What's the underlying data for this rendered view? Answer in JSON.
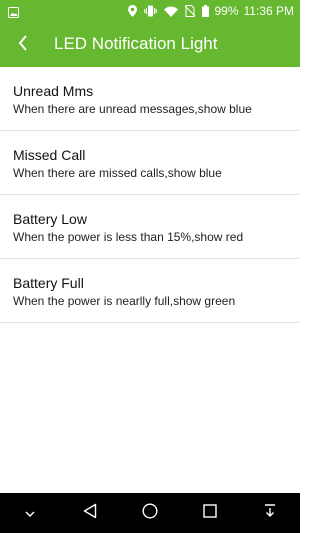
{
  "status_bar": {
    "battery_percent": "99%",
    "time": "11:36 PM"
  },
  "app_bar": {
    "title": "LED Notification Light"
  },
  "settings": {
    "items": [
      {
        "title": "Unread Mms",
        "subtitle": "When there are unread messages,show blue"
      },
      {
        "title": "Missed Call",
        "subtitle": "When there are missed calls,show blue"
      },
      {
        "title": "Battery Low",
        "subtitle": "When the power is less than 15%,show red"
      },
      {
        "title": "Battery Full",
        "subtitle": "When the power is nearlly full,show green"
      }
    ]
  },
  "icons": {
    "status_left": "image-notification-icon",
    "location": "location-icon",
    "vibrate": "vibrate-icon",
    "wifi": "wifi-icon",
    "no_sim": "no-sim-icon",
    "battery": "battery-icon",
    "back": "back-arrow-icon",
    "nav_down": "chevron-down-icon",
    "nav_back": "nav-back-icon",
    "nav_home": "home-icon",
    "nav_recents": "recents-icon",
    "nav_notifications": "pull-down-icon"
  },
  "colors": {
    "accent": "#66b830",
    "nav_bar": "#000000"
  }
}
